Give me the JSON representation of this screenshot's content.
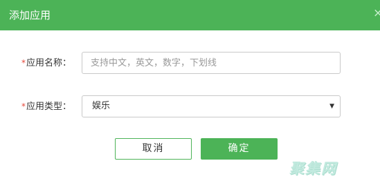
{
  "dialog": {
    "title": "添加应用",
    "close_glyph": "×"
  },
  "form": {
    "required_mark": "*",
    "name": {
      "label": "应用名称：",
      "value": "",
      "placeholder": "支持中文，英文，数字，下划线"
    },
    "type": {
      "label": "应用类型：",
      "selected": "娱乐",
      "caret_glyph": "▼"
    }
  },
  "buttons": {
    "cancel_label": "取消",
    "ok_label": "确定"
  },
  "watermark": {
    "text": "聚集网"
  },
  "colors": {
    "accent": "#4cb357",
    "required": "#e5483a",
    "border": "#c8c8c8"
  },
  "icons": {
    "close": "close-icon",
    "dropdown": "chevron-down-icon"
  }
}
